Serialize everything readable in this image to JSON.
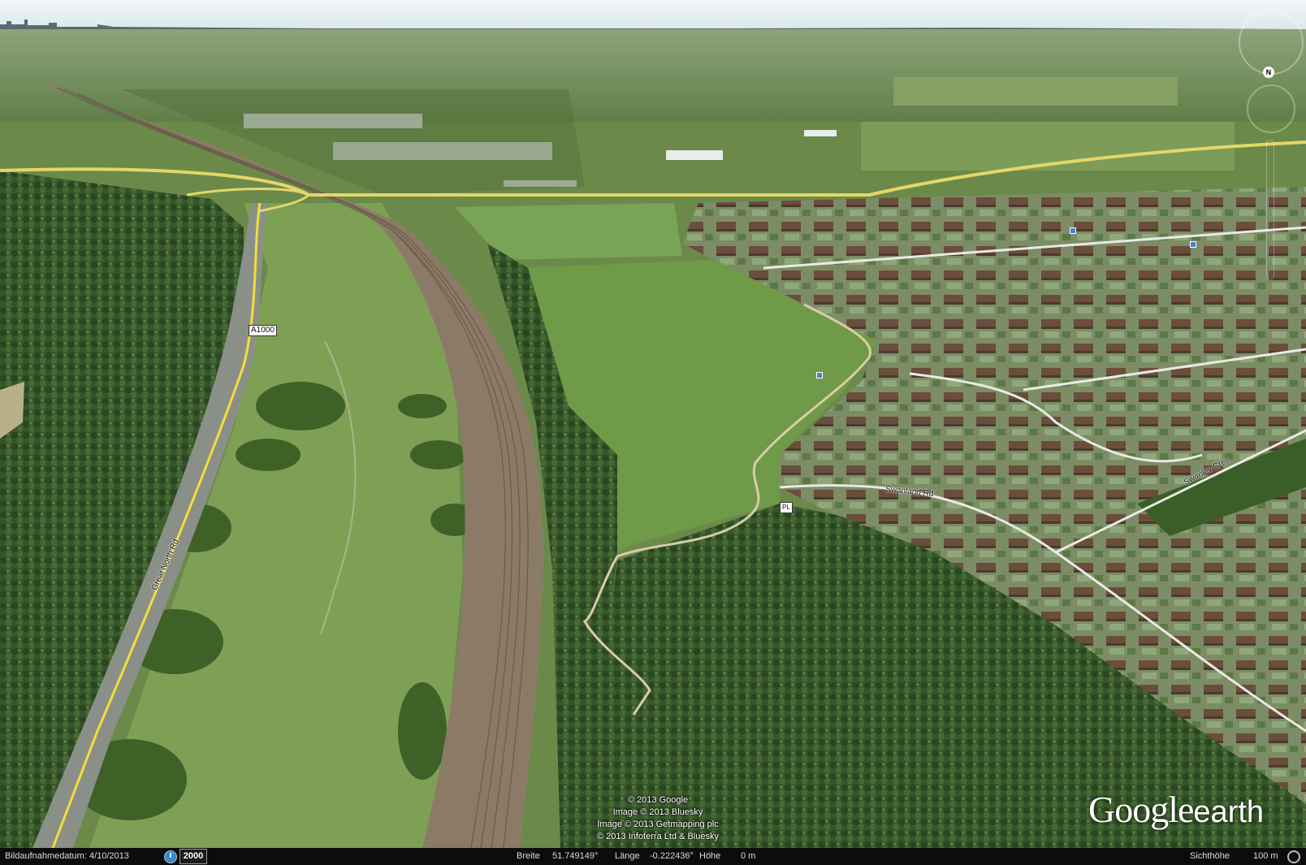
{
  "map": {
    "type": "3d-aerial",
    "imagery_date_label": "Bildaufnahmedatum: 4/10/2013",
    "historical_year": "2000",
    "labels": {
      "road_a1000": "A1000",
      "great_north_road": "Great North Rd",
      "street_a": "Swanland Rd",
      "street_b": "Swanley Cres",
      "marker_a": "PL"
    },
    "colors": {
      "sky": "#e9f2f5",
      "field": "#6f8f4f",
      "forest": "#2f4d24",
      "railway": "#8b7c66",
      "road_yellow": "#f3dd3a",
      "road_white": "#f2f2ee"
    }
  },
  "attribution": {
    "lines": [
      "© 2013 Google",
      "Image © 2013 Bluesky",
      "Image © 2013 Getmapping plc",
      "© 2013 Infoterra Ltd & Bluesky"
    ]
  },
  "logo": {
    "google": "Google",
    "earth": "earth"
  },
  "status": {
    "lat_label": "Breite",
    "lat_value": "51.749149°",
    "lon_label": "Länge",
    "lon_value": "-0.222436°",
    "alt_label": "Höhe",
    "alt_value": "0 m",
    "eye_label": "Sichthöhe",
    "eye_value": "100 m"
  },
  "nav": {
    "north": "N"
  }
}
